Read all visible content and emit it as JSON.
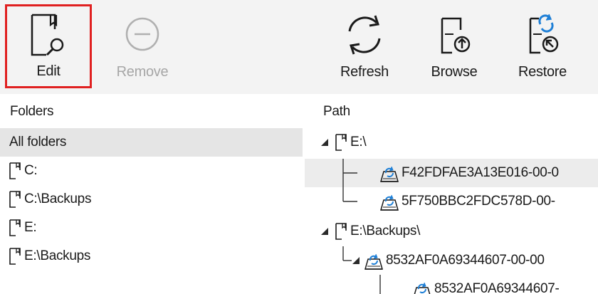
{
  "toolbar": {
    "edit_label": "Edit",
    "remove_label": "Remove",
    "refresh_label": "Refresh",
    "browse_label": "Browse",
    "restore_label": "Restore"
  },
  "folders_panel": {
    "header": "Folders",
    "items": [
      {
        "label": "All folders",
        "selected": true,
        "icon": "none"
      },
      {
        "label": "C:",
        "icon": "document-icon"
      },
      {
        "label": "C:\\Backups",
        "icon": "document-icon"
      },
      {
        "label": "E:",
        "icon": "document-icon"
      },
      {
        "label": "E:\\Backups",
        "icon": "document-icon"
      }
    ]
  },
  "path_panel": {
    "header": "Path",
    "tree": [
      {
        "label": "E:\\",
        "icon": "document-icon",
        "expanded": true
      },
      {
        "label": "F42FDFAE3A13E016-00-0",
        "icon": "backup-drive-icon",
        "highlighted": true
      },
      {
        "label": "5F750BBC2FDC578D-00-",
        "icon": "backup-drive-icon"
      },
      {
        "label": "E:\\Backups\\",
        "icon": "document-icon",
        "expanded": true
      },
      {
        "label": "8532AF0A69344607-00-00",
        "icon": "backup-drive-icon",
        "expanded": true
      },
      {
        "label": "8532AF0A69344607-",
        "icon": "backup-drive-icon"
      }
    ]
  },
  "colors": {
    "toolbar_bg": "#f3f3f3",
    "edit_highlight_border": "#e02020",
    "selected_row_bg": "#e5e5e5",
    "accent_blue": "#1e7fd6",
    "disabled_text": "#a6a6a6"
  }
}
